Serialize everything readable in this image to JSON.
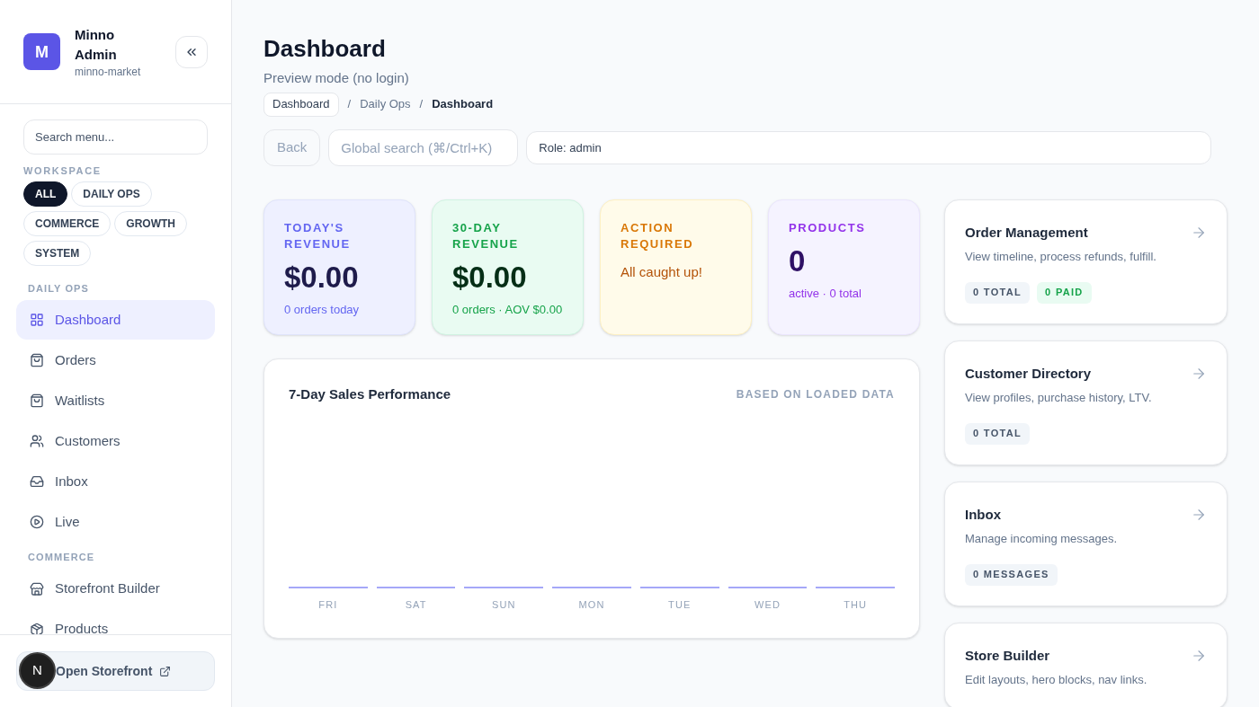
{
  "sidebar": {
    "brand": {
      "initial": "M",
      "name": "Minno Admin",
      "subtitle": "minno-market"
    },
    "search": {
      "placeholder": "Search menu..."
    },
    "workspace_label": "WORKSPACE",
    "filters": [
      {
        "label": "ALL",
        "selected": true
      },
      {
        "label": "DAILY OPS",
        "selected": false
      },
      {
        "label": "COMMERCE",
        "selected": false
      },
      {
        "label": "GROWTH",
        "selected": false
      },
      {
        "label": "SYSTEM",
        "selected": false
      }
    ],
    "sections": [
      {
        "title": "DAILY OPS",
        "items": [
          {
            "label": "Dashboard",
            "selected": true
          },
          {
            "label": "Orders",
            "selected": false
          },
          {
            "label": "Waitlists",
            "selected": false
          },
          {
            "label": "Customers",
            "selected": false
          },
          {
            "label": "Inbox",
            "selected": false
          },
          {
            "label": "Live",
            "selected": false
          }
        ]
      },
      {
        "title": "COMMERCE",
        "items": [
          {
            "label": "Storefront Builder",
            "selected": false
          },
          {
            "label": "Products",
            "selected": false
          }
        ]
      }
    ],
    "footer_button": {
      "label": "Open Storefront"
    },
    "dev_badge": {
      "label": "N"
    }
  },
  "header": {
    "title": "Dashboard",
    "subtitle": "Preview mode (no login)",
    "breadcrumb": [
      {
        "label": "Dashboard",
        "kind": "pill"
      },
      {
        "label": "/",
        "kind": "separator"
      },
      {
        "label": "Daily Ops",
        "kind": "link"
      },
      {
        "label": "/",
        "kind": "separator"
      },
      {
        "label": "Dashboard",
        "kind": "current"
      }
    ],
    "back_button": {
      "label": "Back",
      "disabled": true
    },
    "global_search": {
      "placeholder": "Global search (⌘/Ctrl+K)"
    },
    "role_field": {
      "value": "Role: admin"
    }
  },
  "stats": [
    {
      "kind": "indigo",
      "label": "TODAY'S REVENUE",
      "value": "$0.00",
      "note": "0 orders today"
    },
    {
      "kind": "green",
      "label": "30-DAY REVENUE",
      "value": "$0.00",
      "note": "0 orders · AOV $0.00"
    },
    {
      "kind": "amber",
      "label": "ACTION REQUIRED",
      "message": "All caught up!"
    },
    {
      "kind": "purple",
      "label": "PRODUCTS",
      "value": "0",
      "note": "active · 0 total"
    }
  ],
  "chart": {
    "title": "7-Day Sales Performance",
    "note": "BASED ON LOADED DATA",
    "days": [
      "FRI",
      "SAT",
      "SUN",
      "MON",
      "TUE",
      "WED",
      "THU"
    ]
  },
  "links": [
    {
      "title": "Order Management",
      "description": "View timeline, process refunds, fulfill.",
      "badges": [
        {
          "label": "0 TOTAL",
          "kind": "neutral"
        },
        {
          "label": "0 PAID",
          "kind": "success"
        }
      ]
    },
    {
      "title": "Customer Directory",
      "description": "View profiles, purchase history, LTV.",
      "badges": [
        {
          "label": "0 TOTAL",
          "kind": "neutral"
        }
      ]
    },
    {
      "title": "Inbox",
      "description": "Manage incoming messages.",
      "badges": [
        {
          "label": "0 MESSAGES",
          "kind": "neutral"
        }
      ]
    },
    {
      "title": "Store Builder",
      "description": "Edit layouts, hero blocks, nav links."
    }
  ]
}
